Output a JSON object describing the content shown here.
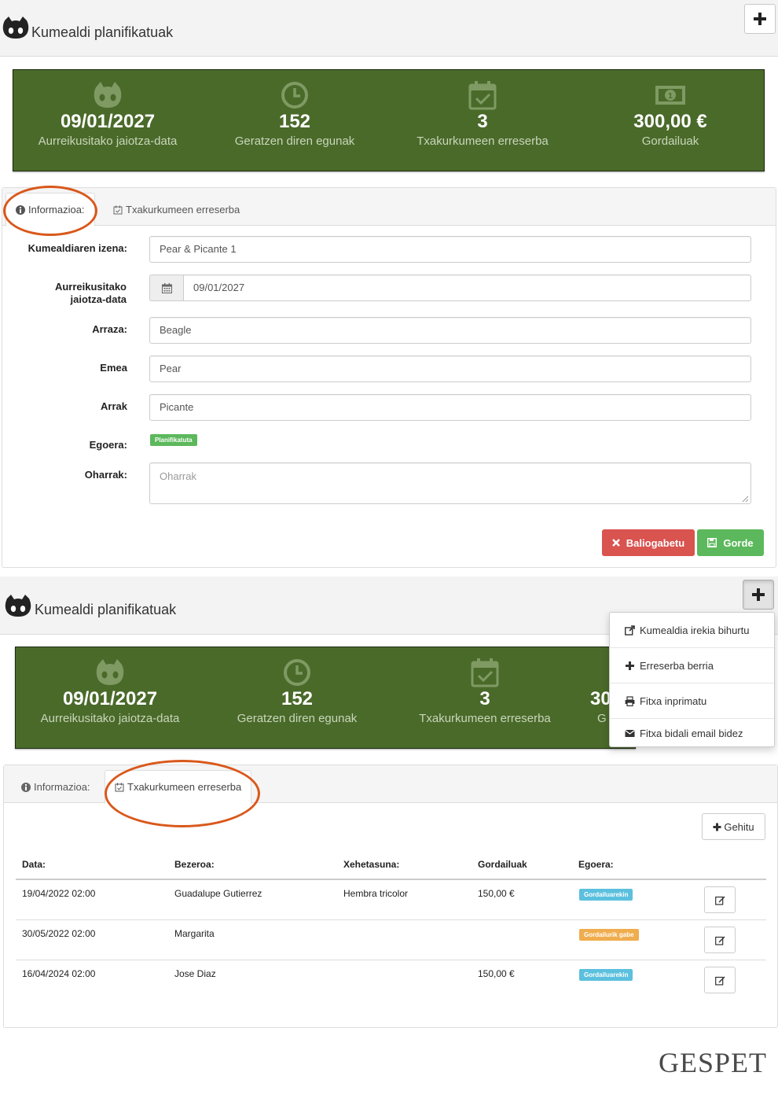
{
  "header": {
    "title": "Kumealdi planifikatuak"
  },
  "stats": [
    {
      "icon": "cat-icon",
      "value": "09/01/2027",
      "label": "Aurreikusitako jaiotza-data"
    },
    {
      "icon": "clock-icon",
      "value": "152",
      "label": "Geratzen diren egunak"
    },
    {
      "icon": "calendar-check-icon",
      "value": "3",
      "label": "Txakurkumeen erreserba"
    },
    {
      "icon": "money-icon",
      "value": "300,00 €",
      "label": "Gordailuak"
    }
  ],
  "tabs": {
    "info": "Informazioa:",
    "reservations": "Txakurkumeen erreserba"
  },
  "form": {
    "name_label": "Kumealdiaren izena:",
    "name_value": "Pear & Picante 1",
    "date_label": "Aurreikusitako jaiotza-data",
    "date_value": "09/01/2027",
    "breed_label": "Arraza:",
    "breed_value": "Beagle",
    "female_label": "Emea",
    "female_value": "Pear",
    "male_label": "Arrak",
    "male_value": "Picante",
    "status_label": "Egoera:",
    "status_value": "Planifikatuta",
    "notes_label": "Oharrak:",
    "notes_placeholder": "Oharrak",
    "cancel_label": "Baliogabetu",
    "save_label": "Gorde"
  },
  "dropdown": {
    "items": [
      "Kumealdia irekia bihurtu",
      "Erreserba berria",
      "Fitxa inprimatu",
      "Fitxa bidali email bidez"
    ]
  },
  "stats2_partial": {
    "value": "30",
    "label": "G"
  },
  "reservations": {
    "add_label": "Gehitu",
    "columns": [
      "Data:",
      "Bezeroa:",
      "Xehetasuna:",
      "Gordailuak",
      "Egoera:"
    ],
    "rows": [
      {
        "date": "19/04/2022 02:00",
        "client": "Guadalupe Gutierrez",
        "detail": "Hembra tricolor",
        "deposit": "150,00 €",
        "status": "Gordailuarekin"
      },
      {
        "date": "30/05/2022 02:00",
        "client": "Margarita",
        "detail": "",
        "deposit": "",
        "status": "Gordailurik gabe"
      },
      {
        "date": "16/04/2024 02:00",
        "client": "Jose Diaz",
        "detail": "",
        "deposit": "150,00 €",
        "status": "Gordailuarekin"
      }
    ]
  },
  "colors": {
    "stats_bg": "#4a6a2a",
    "danger": "#d9534f",
    "success": "#5cb85c",
    "info": "#5bc0de",
    "warning": "#f0ad4e",
    "highlight": "#d9581b"
  },
  "brand": "GESPET"
}
